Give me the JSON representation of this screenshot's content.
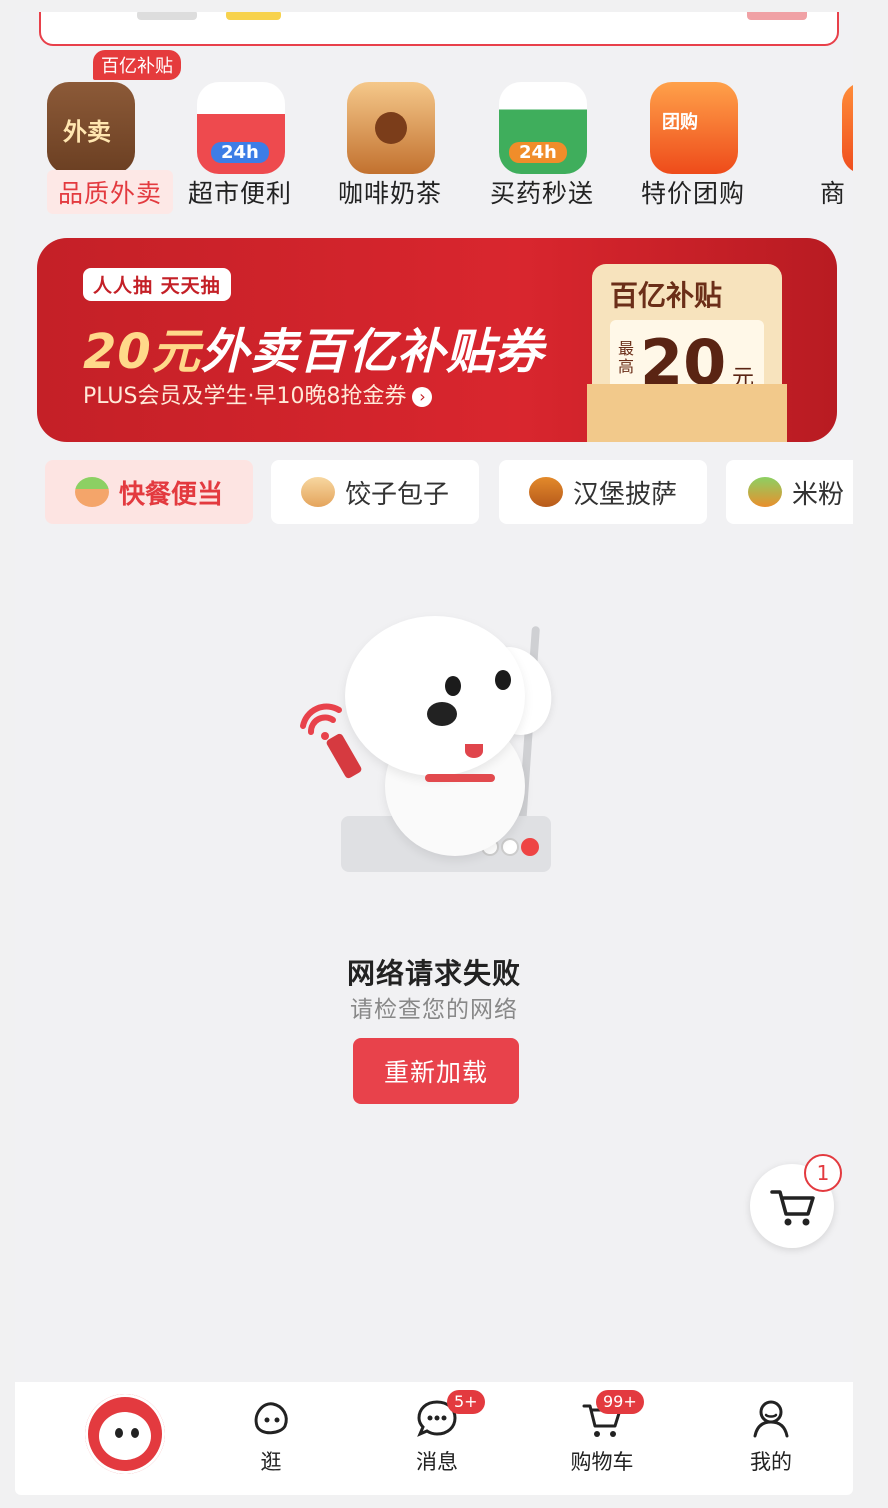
{
  "categories": [
    {
      "label": "品质外卖",
      "icon": "takeout-bag-icon",
      "icon_text": "外卖",
      "badge": "百亿补贴",
      "active": true
    },
    {
      "label": "超市便利",
      "icon": "supermarket-icon",
      "icon_text": "24h"
    },
    {
      "label": "咖啡奶茶",
      "icon": "coffee-cup-icon"
    },
    {
      "label": "买药秒送",
      "icon": "medicine-icon",
      "icon_text": "24h"
    },
    {
      "label": "特价团购",
      "icon": "group-buy-icon",
      "icon_text": "团购"
    },
    {
      "label": "商",
      "icon": "shop-icon"
    }
  ],
  "banner": {
    "tag": "人人抽 天天抽",
    "headline_amount": "20元",
    "headline_text": "外卖百亿补贴券",
    "subtitle": "PLUS会员及学生·早10晚8抢金券",
    "coupon_title": "百亿补贴",
    "coupon_max": "最高",
    "coupon_amount": "20",
    "coupon_unit": "元"
  },
  "subtabs": [
    {
      "label": "快餐便当",
      "icon": "rice-bowl-icon",
      "active": true
    },
    {
      "label": "饺子包子",
      "icon": "dumpling-icon"
    },
    {
      "label": "汉堡披萨",
      "icon": "burger-icon"
    },
    {
      "label": "米粉",
      "icon": "noodle-icon"
    }
  ],
  "error": {
    "title": "网络请求失败",
    "subtitle": "请检查您的网络",
    "button": "重新加载"
  },
  "floating_cart": {
    "count": "1"
  },
  "bottom_nav": [
    {
      "label": "",
      "icon": "jd-home-logo-icon"
    },
    {
      "label": "逛",
      "icon": "browse-icon"
    },
    {
      "label": "消息",
      "icon": "message-icon",
      "badge": "5+"
    },
    {
      "label": "购物车",
      "icon": "cart-icon",
      "badge": "99+"
    },
    {
      "label": "我的",
      "icon": "profile-icon"
    }
  ],
  "colors": {
    "accent": "#e33a3f",
    "banner": "#c42027",
    "background": "#f1f1f3"
  }
}
